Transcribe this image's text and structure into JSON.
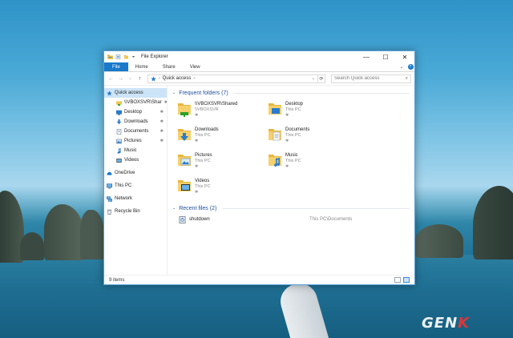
{
  "window": {
    "title": "File Explorer",
    "controls": {
      "minimize": "—",
      "maximize": "☐",
      "close": "✕"
    }
  },
  "ribbon": {
    "tabs": [
      "File",
      "Home",
      "Share",
      "View"
    ],
    "expand": "⌄",
    "help": "?"
  },
  "address_bar": {
    "back": "←",
    "forward": "→",
    "recent": "⌄",
    "up": "↑",
    "path": "Quick access",
    "path_sep": "›",
    "dropdown": "⌄",
    "refresh": "⟳",
    "search_placeholder": "Search Quick access",
    "search_glyph": "⌕"
  },
  "navigation": {
    "pin_glyph": "✱",
    "quick_access": "Quick access",
    "pinned": [
      {
        "label": "\\\\VBOXSVR\\Shar",
        "icon": "network-folder-icon"
      },
      {
        "label": "Desktop",
        "icon": "desktop-folder-icon"
      },
      {
        "label": "Downloads",
        "icon": "downloads-folder-icon"
      },
      {
        "label": "Documents",
        "icon": "documents-folder-icon"
      },
      {
        "label": "Pictures",
        "icon": "pictures-folder-icon"
      },
      {
        "label": "Music",
        "icon": "music-folder-icon"
      },
      {
        "label": "Videos",
        "icon": "videos-folder-icon"
      }
    ],
    "onedrive": "OneDrive",
    "this_pc": "This PC",
    "network": "Network",
    "recycle_bin": "Recycle Bin"
  },
  "frequent_folders": {
    "heading": "Frequent folders (7)",
    "chevron": "⌄",
    "items": [
      {
        "name": "\\\\VBOXSVR\\Shared",
        "location": "\\\\VBOXSVR",
        "icon": "network-folder-icon"
      },
      {
        "name": "Desktop",
        "location": "This PC",
        "icon": "desktop-folder-icon"
      },
      {
        "name": "Downloads",
        "location": "This PC",
        "icon": "downloads-folder-icon"
      },
      {
        "name": "Documents",
        "location": "This PC",
        "icon": "documents-folder-icon"
      },
      {
        "name": "Pictures",
        "location": "This PC",
        "icon": "pictures-folder-icon"
      },
      {
        "name": "Music",
        "location": "This PC",
        "icon": "music-folder-icon"
      },
      {
        "name": "Videos",
        "location": "This PC",
        "icon": "videos-folder-icon"
      }
    ]
  },
  "recent_files": {
    "heading": "Recent files (2)",
    "chevron": "⌄",
    "items": [
      {
        "name": "shutdown",
        "path": "This PC\\Documents",
        "icon": "script-file-icon"
      }
    ]
  },
  "status_bar": {
    "item_count": "9 items"
  },
  "watermark": {
    "text_main": "GEN",
    "text_accent": "K"
  },
  "colors": {
    "accent": "#1979ca",
    "folder": "#f3c652",
    "selection": "#cce4f7",
    "heading": "#1e4e9c"
  }
}
